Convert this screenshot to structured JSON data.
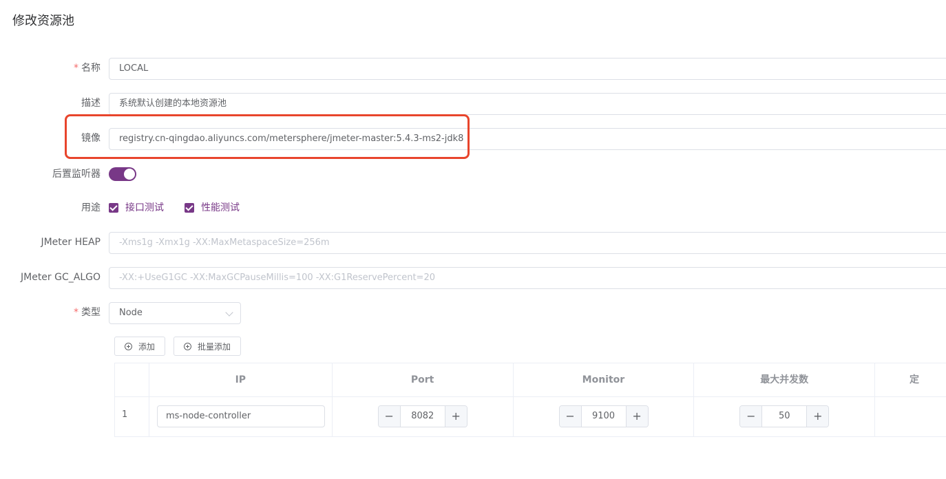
{
  "page": {
    "title": "修改资源池"
  },
  "form": {
    "name": {
      "label": "名称",
      "required_mark": "*",
      "value": "LOCAL"
    },
    "description": {
      "label": "描述",
      "value": "系统默认创建的本地资源池"
    },
    "image": {
      "label": "镜像",
      "value": "registry.cn-qingdao.aliyuncs.com/metersphere/jmeter-master:5.4.3-ms2-jdk8"
    },
    "post_listener": {
      "label": "后置监听器",
      "enabled": true
    },
    "usage": {
      "label": "用途",
      "options": [
        {
          "label": "接口测试",
          "checked": true
        },
        {
          "label": "性能测试",
          "checked": true
        }
      ]
    },
    "jmeter_heap": {
      "label": "JMeter HEAP",
      "placeholder": "-Xms1g -Xmx1g -XX:MaxMetaspaceSize=256m"
    },
    "jmeter_gc_algo": {
      "label": "JMeter GC_ALGO",
      "placeholder": "-XX:+UseG1GC -XX:MaxGCPauseMillis=100 -XX:G1ReservePercent=20"
    },
    "type": {
      "label": "类型",
      "required_mark": "*",
      "value": "Node"
    }
  },
  "toolbar": {
    "add_label": "添加",
    "batch_add_label": "批量添加"
  },
  "table": {
    "columns": [
      "",
      "IP",
      "Port",
      "Monitor",
      "最大并发数",
      "定"
    ],
    "rows": [
      {
        "index": "1",
        "ip": "ms-node-controller",
        "port": "8082",
        "monitor": "9100",
        "max_concurrency": "50"
      }
    ]
  },
  "icons": {
    "stepper_minus": "−",
    "stepper_plus": "+"
  },
  "colors": {
    "accent": "#783887",
    "highlight": "#e8452c",
    "required": "#f56c6c"
  }
}
